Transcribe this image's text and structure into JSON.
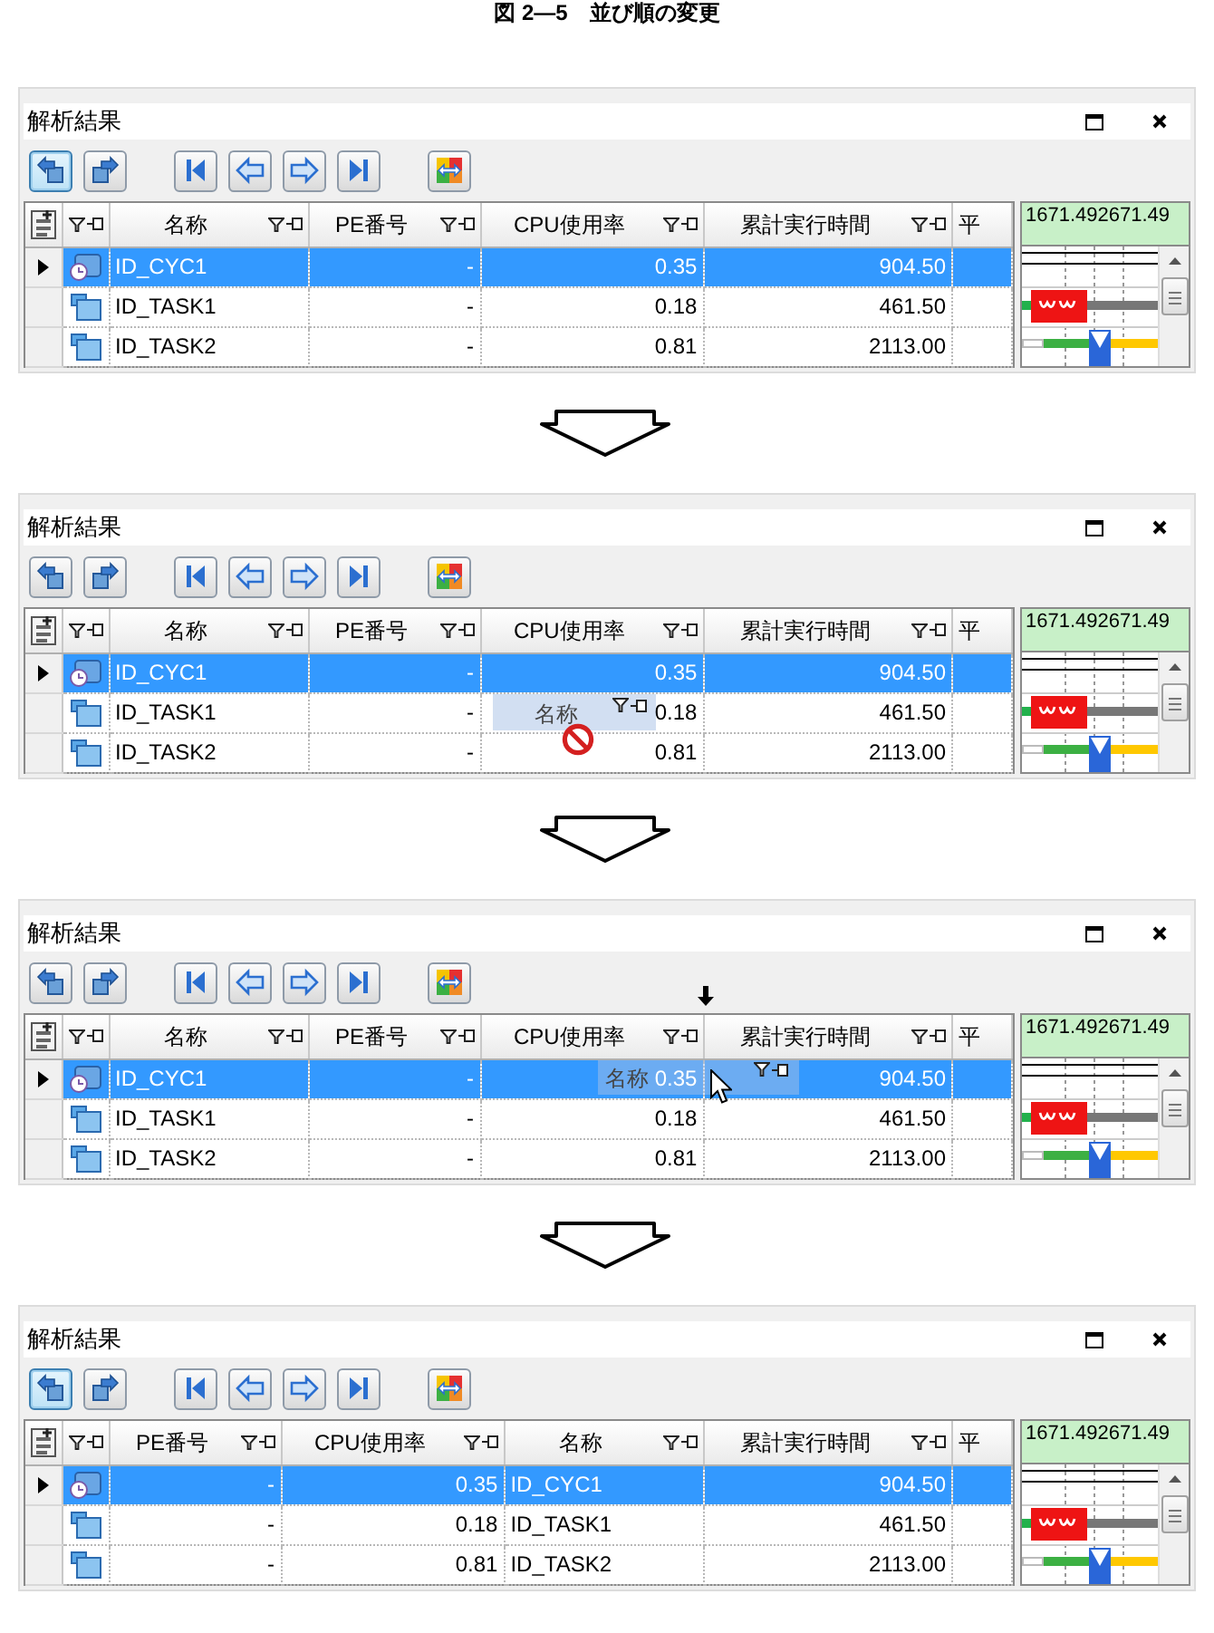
{
  "caption": "図 2—5　並び順の変更",
  "panels": [
    {
      "title": "解析結果",
      "toolbar": [
        [
          {
            "kind": "back",
            "highlighted": true
          },
          {
            "kind": "forward",
            "highlighted": false
          }
        ],
        [
          {
            "kind": "first",
            "highlighted": false
          },
          {
            "kind": "previous",
            "highlighted": false
          },
          {
            "kind": "next",
            "highlighted": false
          },
          {
            "kind": "last",
            "highlighted": false
          }
        ],
        [
          {
            "kind": "swap",
            "highlighted": false
          }
        ]
      ],
      "columns": [
        {
          "kind": "name",
          "label": "名称"
        },
        {
          "kind": "number",
          "label": "PE番号"
        },
        {
          "kind": "number",
          "label": "CPU使用率"
        },
        {
          "kind": "number",
          "label": "累計実行時間"
        },
        {
          "kind": "clipped",
          "label": "平"
        }
      ],
      "rows": [
        {
          "kind": "cyclic",
          "current": true,
          "selected": true,
          "cells": [
            "ID_CYC1",
            "-",
            "0.35",
            "904.50"
          ]
        },
        {
          "kind": "task",
          "current": false,
          "selected": false,
          "cells": [
            "ID_TASK1",
            "-",
            "0.18",
            "461.50"
          ]
        },
        {
          "kind": "task",
          "current": false,
          "selected": false,
          "cells": [
            "ID_TASK2",
            "-",
            "0.81",
            "2113.00"
          ]
        }
      ],
      "timeline": {
        "scale": "1671.492671.49"
      }
    },
    {
      "title": "解析結果",
      "toolbar": [
        [
          {
            "kind": "back",
            "highlighted": false
          },
          {
            "kind": "forward",
            "highlighted": false
          }
        ],
        [
          {
            "kind": "first",
            "highlighted": false
          },
          {
            "kind": "previous",
            "highlighted": false
          },
          {
            "kind": "next",
            "highlighted": false
          },
          {
            "kind": "last",
            "highlighted": false
          }
        ],
        [
          {
            "kind": "swap",
            "highlighted": false
          }
        ]
      ],
      "columns": [
        {
          "kind": "name",
          "label": "名称"
        },
        {
          "kind": "number",
          "label": "PE番号"
        },
        {
          "kind": "number",
          "label": "CPU使用率"
        },
        {
          "kind": "number",
          "label": "累計実行時間"
        },
        {
          "kind": "clipped",
          "label": "平"
        }
      ],
      "rows": [
        {
          "kind": "cyclic",
          "current": true,
          "selected": true,
          "cells": [
            "ID_CYC1",
            "-",
            "0.35",
            "904.50"
          ]
        },
        {
          "kind": "task",
          "current": false,
          "selected": false,
          "cells": [
            "ID_TASK1",
            "-",
            "0.18",
            "461.50"
          ]
        },
        {
          "kind": "task",
          "current": false,
          "selected": false,
          "cells": [
            "ID_TASK2",
            "-",
            "0.81",
            "2113.00"
          ]
        }
      ],
      "drag": {
        "label": "名称",
        "allowed": false
      },
      "timeline": {
        "scale": "1671.492671.49"
      }
    },
    {
      "title": "解析結果",
      "toolbar": [
        [
          {
            "kind": "back",
            "highlighted": false
          },
          {
            "kind": "forward",
            "highlighted": false
          }
        ],
        [
          {
            "kind": "first",
            "highlighted": false
          },
          {
            "kind": "previous",
            "highlighted": false
          },
          {
            "kind": "next",
            "highlighted": false
          },
          {
            "kind": "last",
            "highlighted": false
          }
        ],
        [
          {
            "kind": "swap",
            "highlighted": false
          }
        ]
      ],
      "columns": [
        {
          "kind": "name",
          "label": "名称"
        },
        {
          "kind": "number",
          "label": "PE番号"
        },
        {
          "kind": "number",
          "label": "CPU使用率"
        },
        {
          "kind": "number",
          "label": "累計実行時間"
        },
        {
          "kind": "clipped",
          "label": "平"
        }
      ],
      "rows": [
        {
          "kind": "cyclic",
          "current": true,
          "selected": true,
          "cells": [
            "ID_CYC1",
            "-",
            "0.35",
            "904.50"
          ]
        },
        {
          "kind": "task",
          "current": false,
          "selected": false,
          "cells": [
            "ID_TASK1",
            "-",
            "0.18",
            "461.50"
          ]
        },
        {
          "kind": "task",
          "current": false,
          "selected": false,
          "cells": [
            "ID_TASK2",
            "-",
            "0.81",
            "2113.00"
          ]
        }
      ],
      "drag": {
        "label": "名称",
        "allowed": true
      },
      "timeline": {
        "scale": "1671.492671.49"
      }
    },
    {
      "title": "解析結果",
      "toolbar": [
        [
          {
            "kind": "back",
            "highlighted": true
          },
          {
            "kind": "forward",
            "highlighted": false
          }
        ],
        [
          {
            "kind": "first",
            "highlighted": false
          },
          {
            "kind": "previous",
            "highlighted": false
          },
          {
            "kind": "next",
            "highlighted": false
          },
          {
            "kind": "last",
            "highlighted": false
          }
        ],
        [
          {
            "kind": "swap",
            "highlighted": false
          }
        ]
      ],
      "columns": [
        {
          "kind": "number",
          "label": "PE番号"
        },
        {
          "kind": "number",
          "label": "CPU使用率"
        },
        {
          "kind": "name",
          "label": "名称"
        },
        {
          "kind": "number",
          "label": "累計実行時間"
        },
        {
          "kind": "clipped",
          "label": "平"
        }
      ],
      "rows": [
        {
          "kind": "cyclic",
          "current": true,
          "selected": true,
          "cells": [
            "-",
            "0.35",
            "ID_CYC1",
            "904.50"
          ]
        },
        {
          "kind": "task",
          "current": false,
          "selected": false,
          "cells": [
            "-",
            "0.18",
            "ID_TASK1",
            "461.50"
          ]
        },
        {
          "kind": "task",
          "current": false,
          "selected": false,
          "cells": [
            "-",
            "0.81",
            "ID_TASK2",
            "2113.00"
          ]
        }
      ],
      "timeline": {
        "scale": "1671.492671.49"
      }
    }
  ]
}
